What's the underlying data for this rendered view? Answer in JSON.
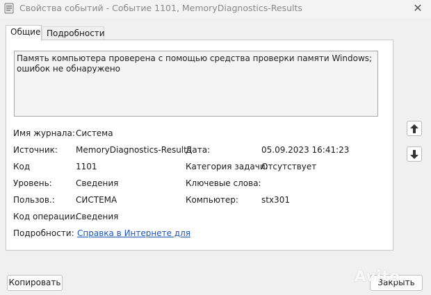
{
  "window": {
    "title": "Свойства событий - Событие 1101, MemoryDiagnostics-Results",
    "close_glyph": "✕"
  },
  "tabs": [
    {
      "label": "Общие",
      "active": true
    },
    {
      "label": "Подробности",
      "active": false
    }
  ],
  "description": "Память компьютера проверена с помощью средства проверки памяти Windows; ошибок не обнаружено",
  "fields": {
    "log_name": {
      "label": "Имя журнала:",
      "value": "Система"
    },
    "source": {
      "label": "Источник:",
      "value": "MemoryDiagnostics-Results"
    },
    "logged": {
      "label": "Дата:",
      "value": "05.09.2023 16:41:23"
    },
    "event_id": {
      "label": "Код",
      "value": "1101"
    },
    "task_category": {
      "label": "Категория задачи:",
      "value": "Отсутствует"
    },
    "level": {
      "label": "Уровень:",
      "value": "Сведения"
    },
    "keywords": {
      "label": "Ключевые слова:",
      "value": ""
    },
    "user": {
      "label": "Пользов.:",
      "value": "СИСТЕМА"
    },
    "computer": {
      "label": "Компьютер:",
      "value": "stx301"
    },
    "opcode": {
      "label": "Код операции:",
      "value": "Сведения"
    },
    "more_info": {
      "label": "Подробности:",
      "link_text": "Справка в Интернете для"
    }
  },
  "nav": {
    "up_icon": "arrow-up-icon",
    "down_icon": "arrow-down-icon"
  },
  "buttons": {
    "copy": "Копировать",
    "close": "Закрыть"
  },
  "watermark": "Avito",
  "colors": {
    "link": "#1a55b8",
    "title_text": "#8a8a8a",
    "background": "#f0f0f0"
  }
}
